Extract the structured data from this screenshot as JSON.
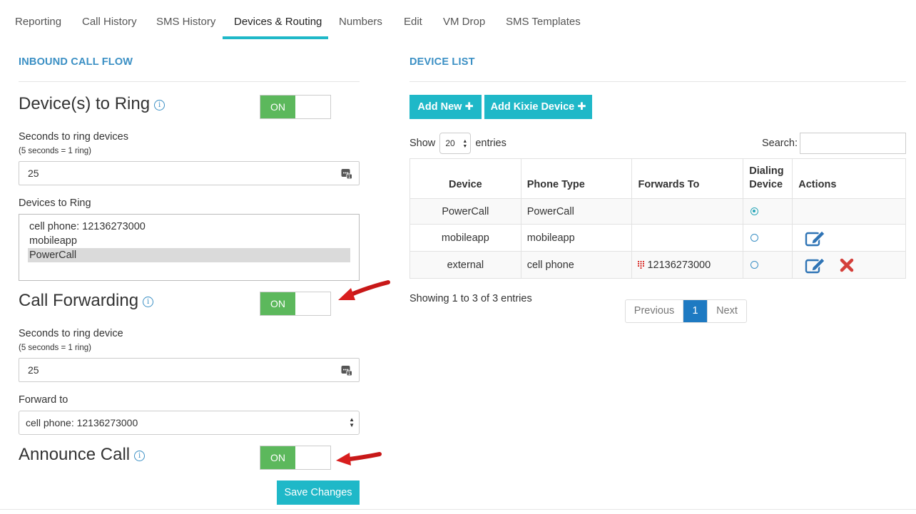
{
  "tabs": [
    {
      "label": "Reporting"
    },
    {
      "label": "Call History"
    },
    {
      "label": "SMS History"
    },
    {
      "label": "Devices & Routing",
      "active": true
    },
    {
      "label": "Numbers"
    },
    {
      "label": "Edit"
    },
    {
      "label": "VM Drop"
    },
    {
      "label": "SMS Templates"
    }
  ],
  "inbound": {
    "title": "INBOUND CALL FLOW",
    "devices_to_ring": {
      "label": "Device(s) to Ring",
      "toggle": "ON"
    },
    "seconds_devices": {
      "label": "Seconds to ring devices",
      "hint": "(5 seconds = 1 ring)",
      "value": "25"
    },
    "devices_list": {
      "label": "Devices to Ring",
      "options": [
        "cell phone: 12136273000",
        "mobileapp",
        "PowerCall"
      ],
      "selected": "PowerCall"
    },
    "call_forwarding": {
      "label": "Call Forwarding",
      "toggle": "ON"
    },
    "seconds_device": {
      "label": "Seconds to ring device",
      "hint": "(5 seconds = 1 ring)",
      "value": "25"
    },
    "forward_to": {
      "label": "Forward to",
      "value": "cell phone: 12136273000"
    },
    "announce_call": {
      "label": "Announce Call",
      "toggle": "ON"
    },
    "save_label": "Save Changes"
  },
  "device_list": {
    "title": "DEVICE LIST",
    "add_new": "Add New",
    "add_kixie": "Add Kixie Device",
    "show_prefix": "Show",
    "entries_value": "20",
    "show_suffix": "entries",
    "search_label": "Search:",
    "columns": [
      "Device",
      "Phone Type",
      "Forwards To",
      "Dialing Device",
      "Actions"
    ],
    "rows": [
      {
        "device": "PowerCall",
        "phone_type": "PowerCall",
        "forwards_to": "",
        "dialing": true,
        "editable": false,
        "deletable": false
      },
      {
        "device": "mobileapp",
        "phone_type": "mobileapp",
        "forwards_to": "",
        "dialing": false,
        "editable": true,
        "deletable": false
      },
      {
        "device": "external",
        "phone_type": "cell phone",
        "forwards_to": "12136273000",
        "dialing": false,
        "editable": true,
        "deletable": true
      }
    ],
    "info": "Showing 1 to 3 of 3 entries",
    "pagination": {
      "previous": "Previous",
      "current": "1",
      "next": "Next"
    }
  },
  "colors": {
    "accent": "#1fb8c8",
    "heading": "#3a8fc4",
    "toggle_on": "#5cb85c",
    "page_active": "#1e7ac2",
    "arrow": "#e01f1f"
  }
}
